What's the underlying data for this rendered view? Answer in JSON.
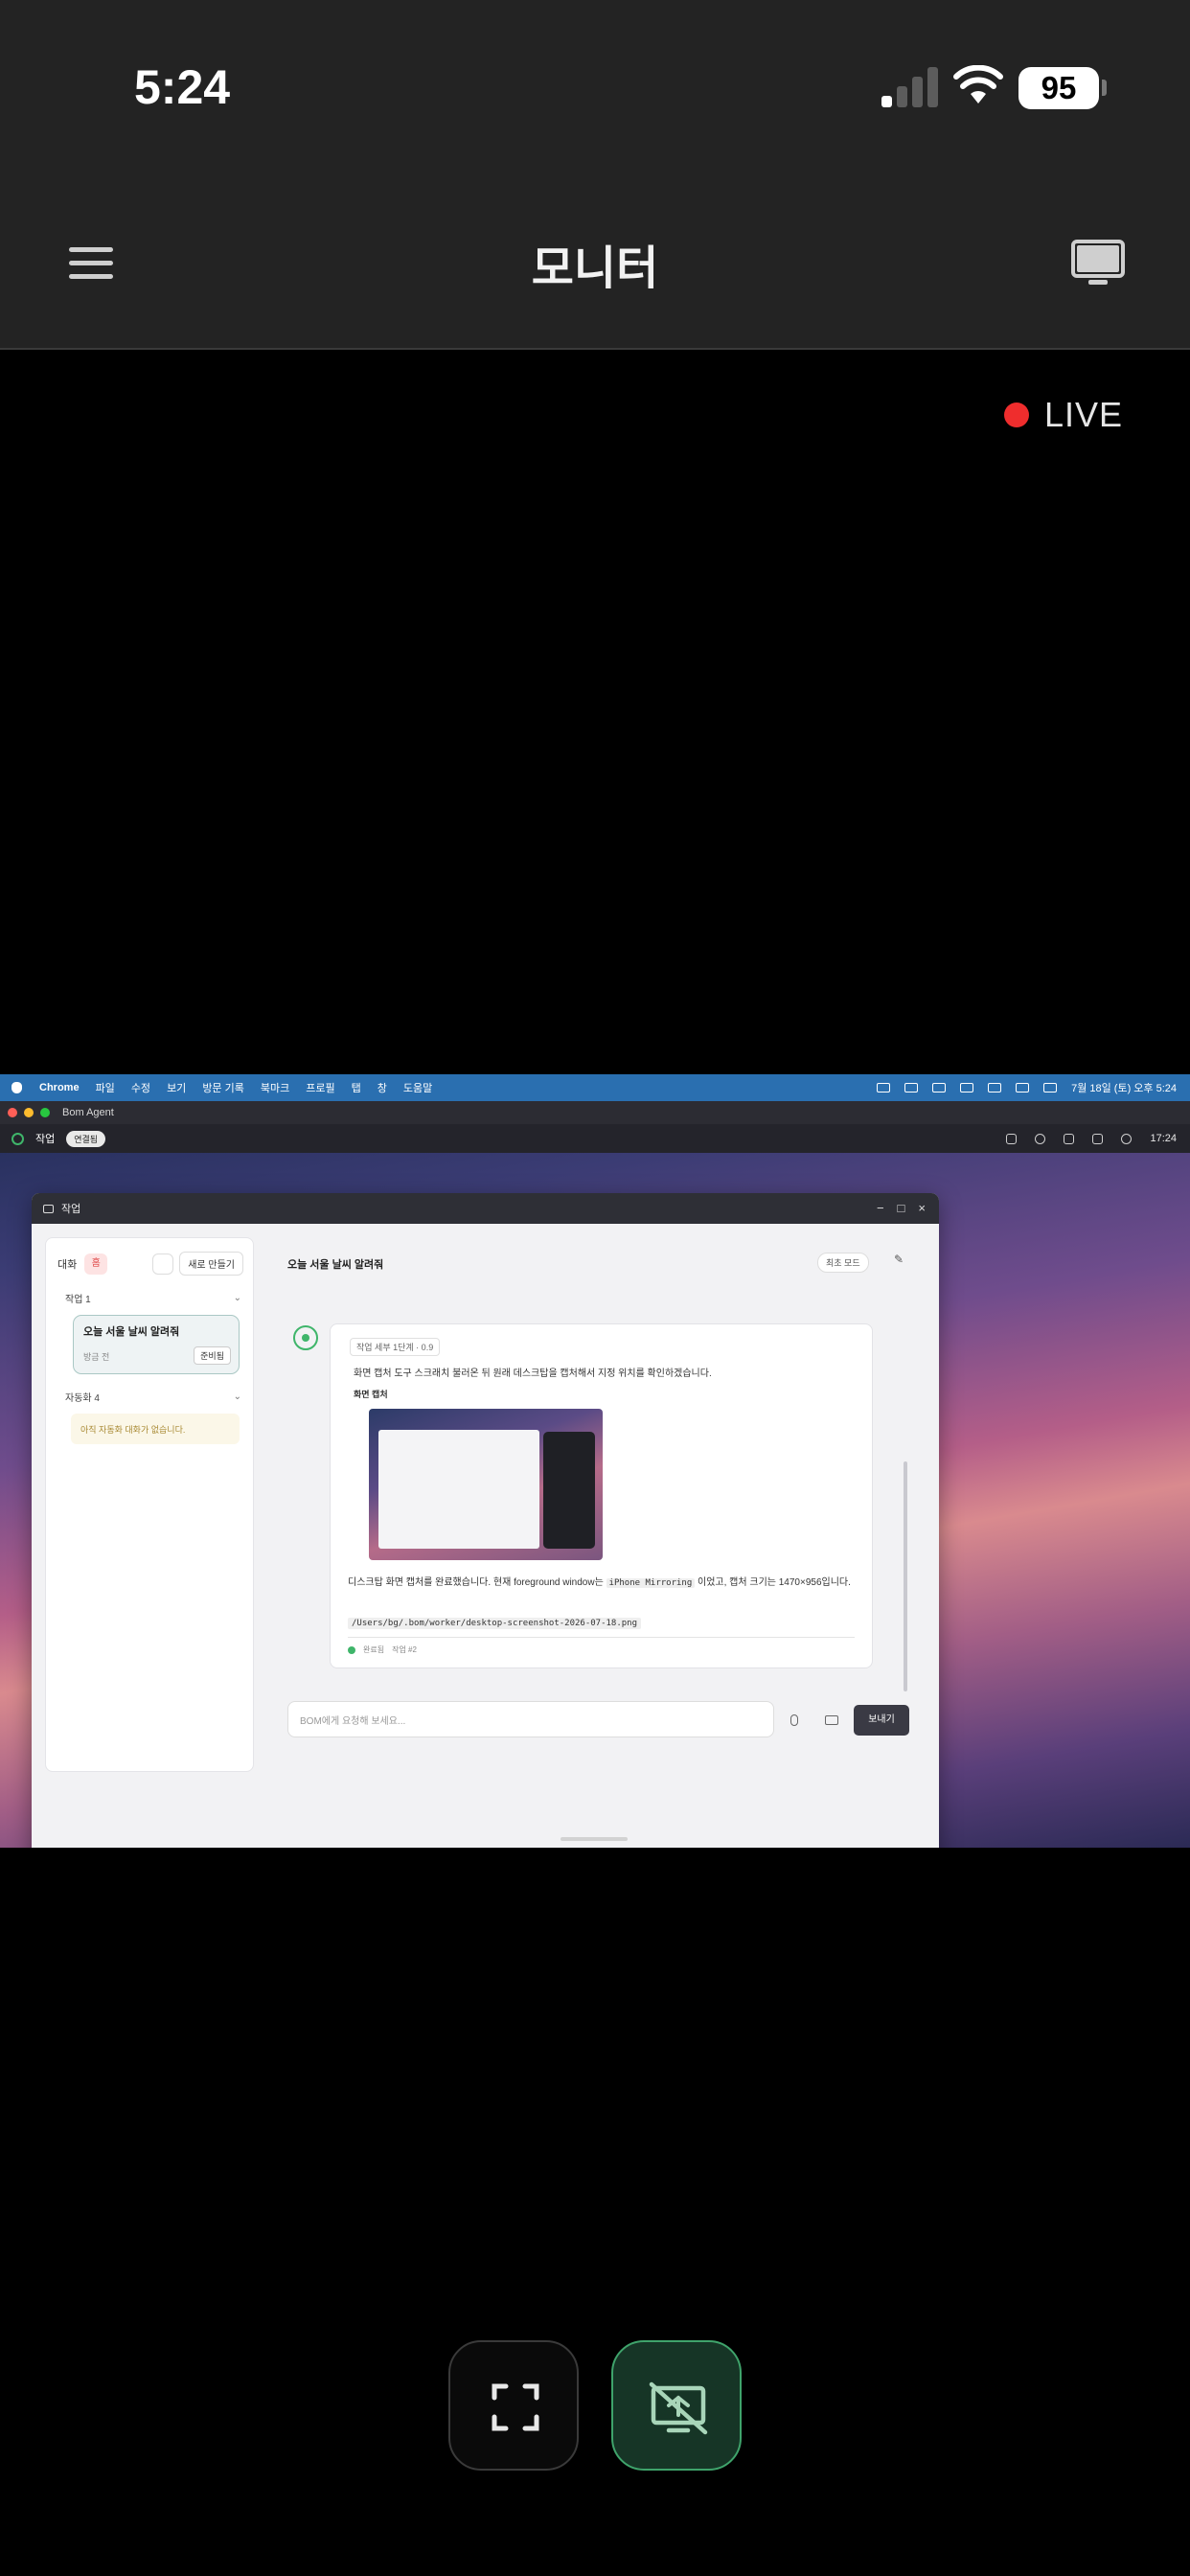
{
  "status_bar": {
    "time": "5:24",
    "battery": "95"
  },
  "header": {
    "title": "모니터"
  },
  "live_label": "LIVE",
  "mac": {
    "menubar": {
      "app_name": "Chrome",
      "menus": [
        "파일",
        "수정",
        "보기",
        "방문 기록",
        "북마크",
        "프로필",
        "탭",
        "창",
        "도움말"
      ],
      "clock": "7월 18일 (토) 오후 5:24"
    },
    "app_title": "Bom Agent",
    "toolbar": {
      "label": "작업",
      "status_pill": "연결됨",
      "time": "17:24"
    },
    "window": {
      "title": "작업",
      "sidebar": {
        "tab_label": "대화",
        "tab_chip": "홈",
        "new_button": "새로 만들기",
        "tasks_section": "작업 1",
        "task_title": "오늘 서울 날씨 알려줘",
        "task_subtitle": "방금 전",
        "task_badge": "준비됨",
        "automation_section": "자동화 4",
        "warning": "아직 자동화 대화가 없습니다."
      },
      "chat": {
        "title": "오늘 서울 날씨 알려줘",
        "sync_button": "최초 모드",
        "step_summary": "작업 세부 1단계 · 0.9",
        "message_1": "화면 캡처 도구 스크래치 불러온 뒤 원래 데스크탑을 캡처해서 지정 위치를 확인하겠습니다.",
        "tool_label": "화면 캡처",
        "message_2_before": "디스크탑 화면 캡처를 완료했습니다. 현재 foreground window는 ",
        "message_2_code": "iPhone Mirroring",
        "message_2_after": " 이었고, 캡처 크기는 1470×956입니다.",
        "file_path": "/Users/bg/.bom/worker/desktop-screenshot-2026-07-18.png",
        "footer_status": "완료됨",
        "footer_steps": "작업 #2",
        "input_placeholder": "BOM에게 요청해 보세요...",
        "send_button": "보내기"
      }
    }
  },
  "controls": {
    "fullscreen_icon": "fullscreen-icon",
    "screen_off_icon": "screen-share-off-icon"
  },
  "colors": {
    "live_red": "#ef2d2d",
    "accent_green": "#3fb56a",
    "mac_menubar": "#2a6fb0"
  }
}
